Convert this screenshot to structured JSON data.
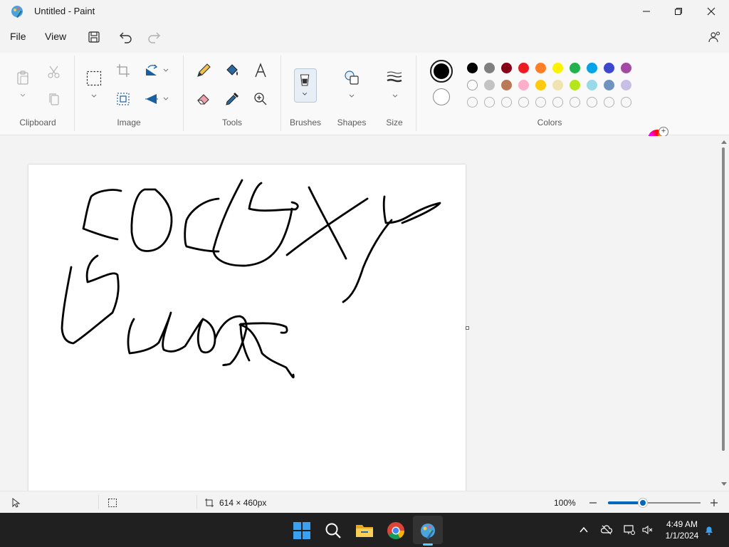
{
  "window": {
    "title": "Untitled - Paint"
  },
  "menu": {
    "file": "File",
    "view": "View"
  },
  "ribbon": {
    "groups": {
      "clipboard": "Clipboard",
      "image": "Image",
      "tools": "Tools",
      "brushes": "Brushes",
      "shapes": "Shapes",
      "size": "Size",
      "colors": "Colors"
    },
    "palette_row1": [
      "#000000",
      "#7f7f7f",
      "#880015",
      "#ed1c24",
      "#ff7f27",
      "#fff200",
      "#22b14c",
      "#00a2e8",
      "#3f48cc",
      "#a349a4"
    ],
    "palette_row2": [
      "#ffffff",
      "#c3c3c3",
      "#b97a57",
      "#ffaec9",
      "#ffc90e",
      "#efe4b0",
      "#b5e61d",
      "#99d9ea",
      "#7092be",
      "#c8bfe7"
    ],
    "custom_slots": 10,
    "primary_color": "#000000",
    "secondary_color": "#ffffff"
  },
  "status": {
    "canvas_size": "614 × 460px",
    "zoom": "100%",
    "zoom_fraction": 0.38
  },
  "taskbar": {
    "time": "4:49 AM",
    "date": "1/1/2024"
  }
}
